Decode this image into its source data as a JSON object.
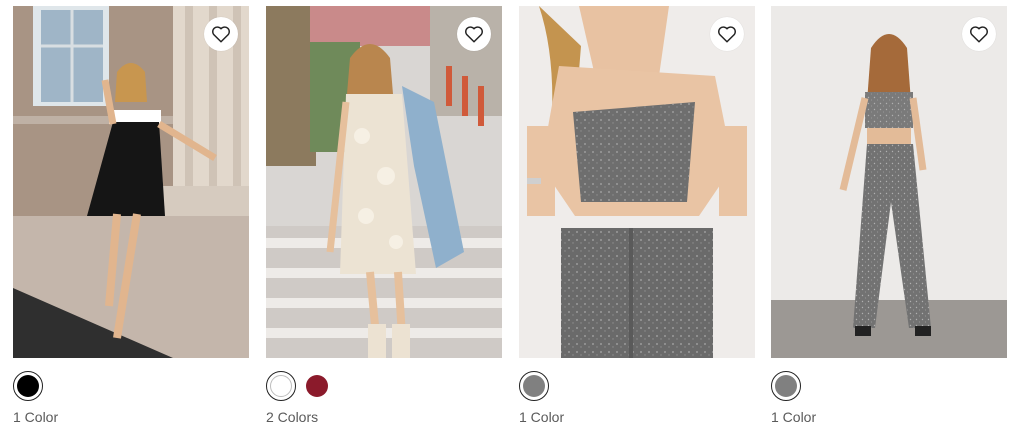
{
  "products": [
    {
      "image_alt": "Woman in black mini dress with white collar leaning against stone building",
      "favorite_icon": "heart-outline-icon",
      "swatches": [
        {
          "color": "#000000",
          "selected": true
        }
      ],
      "color_count": "1 Color"
    },
    {
      "image_alt": "Woman in cream sequin floral mini dress with denim jacket and white boots",
      "favorite_icon": "heart-outline-icon",
      "swatches": [
        {
          "color": "#ffffff",
          "selected": true
        },
        {
          "color": "#8b1a2b",
          "selected": false
        }
      ],
      "color_count": "2 Colors"
    },
    {
      "image_alt": "Close-up of woman in grey sparkle tweed tube top and matching pants",
      "favorite_icon": "heart-outline-icon",
      "swatches": [
        {
          "color": "#808080",
          "selected": true
        }
      ],
      "color_count": "1 Color"
    },
    {
      "image_alt": "Woman in grey sparkle tweed tube top and wide-leg pants set in studio",
      "favorite_icon": "heart-outline-icon",
      "swatches": [
        {
          "color": "#808080",
          "selected": true
        }
      ],
      "color_count": "1 Color"
    }
  ]
}
